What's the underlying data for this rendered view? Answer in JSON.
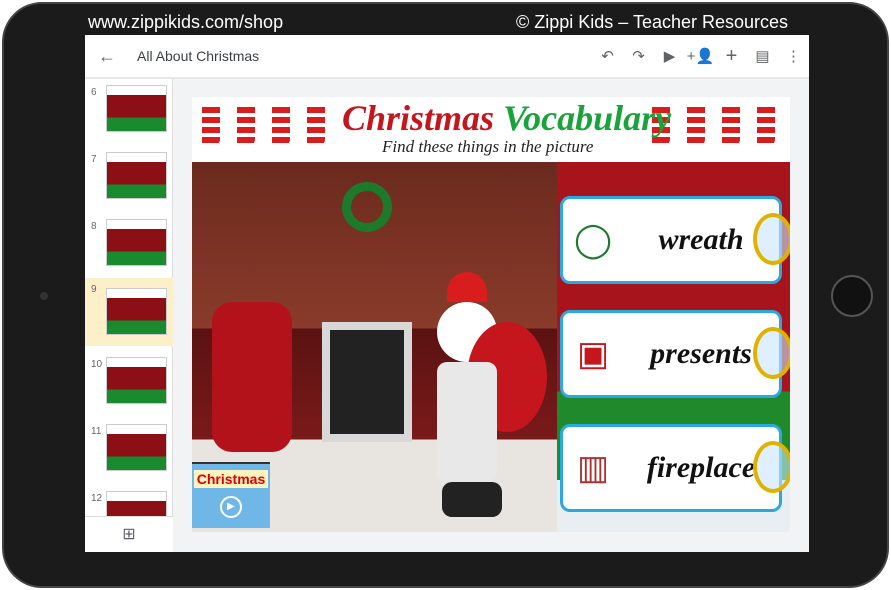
{
  "overlay": {
    "url": "www.zippikids.com/shop",
    "credit": "© Zippi Kids – Teacher Resources"
  },
  "appbar": {
    "title": "All About Christmas",
    "icons": [
      "arrow-left-icon",
      "undo-icon",
      "redo-icon",
      "play-icon",
      "add-person-icon",
      "plus-icon",
      "comment-icon",
      "more-vert-icon"
    ]
  },
  "filmstrip": {
    "slides": [
      {
        "num": "6"
      },
      {
        "num": "7"
      },
      {
        "num": "8"
      },
      {
        "num": "9",
        "selected": true
      },
      {
        "num": "10"
      },
      {
        "num": "11"
      },
      {
        "num": "12"
      }
    ]
  },
  "slide": {
    "title_word1": "Christmas",
    "title_word2": "Vocabulary",
    "subtitle": "Find these things in the picture",
    "title_colors": {
      "word1": "#c4161c",
      "word2": "#1aa33a"
    },
    "cards": [
      {
        "word": "wreath",
        "icon": "wreath-icon"
      },
      {
        "word": "presents",
        "icon": "gift-icon"
      },
      {
        "word": "fireplace",
        "icon": "fireplace-icon"
      }
    ],
    "video_label": "Christmas"
  }
}
